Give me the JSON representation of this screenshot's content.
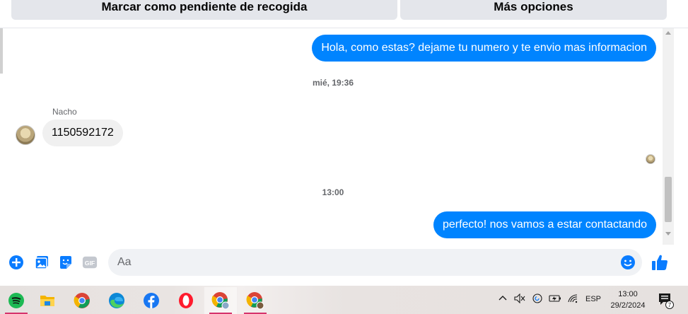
{
  "top_actions": {
    "mark_pending": "Marcar como pendiente de recogida",
    "more_options": "Más opciones"
  },
  "messages": {
    "outgoing_1": "Hola, como estas? dejame tu numero y te envio mas informacion",
    "timestamp_1": "mié, 19:36",
    "sender_name": "Nacho",
    "incoming_1": "1150592172",
    "timestamp_2": "13:00",
    "outgoing_2": "perfecto! nos vamos a estar contactando"
  },
  "composer": {
    "placeholder": "Aa",
    "icons": [
      "plus-circle-icon",
      "photo-icon",
      "sticker-icon",
      "gif-icon",
      "emoji-icon",
      "thumbs-up-icon"
    ],
    "gif_label": "GIF"
  },
  "taskbar": {
    "apps": [
      "spotify-icon",
      "file-explorer-icon",
      "chrome-icon",
      "edge-icon",
      "facebook-icon",
      "opera-icon",
      "chrome-profile-icon",
      "chrome-profile-2-icon"
    ],
    "language": "ESP",
    "time": "13:00",
    "date": "29/2/2024",
    "notification_count": "7"
  },
  "colors": {
    "messenger_blue": "#0084ff",
    "incoming_bubble": "#f0f0f0",
    "composer_icon": "#0a7cff"
  }
}
